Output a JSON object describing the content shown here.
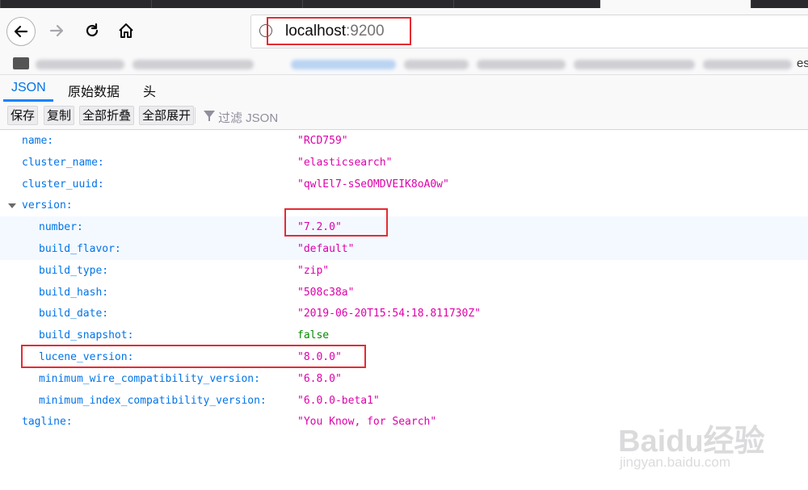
{
  "browser": {
    "url_host": "localhost",
    "url_port": ":9200",
    "bookmark_tail": "es"
  },
  "viewer_tabs": [
    "JSON",
    "原始数据",
    "头"
  ],
  "toolbar": {
    "save": "保存",
    "copy": "复制",
    "collapse_all": "全部折叠",
    "expand_all": "全部展开",
    "filter_placeholder": "过滤 JSON"
  },
  "json": {
    "name": {
      "key": "name:",
      "value": "\"RCD759\""
    },
    "cluster_name": {
      "key": "cluster_name:",
      "value": "\"elasticsearch\""
    },
    "cluster_uuid": {
      "key": "cluster_uuid:",
      "value": "\"qwlEl7-sSeOMDVEIK8oA0w\""
    },
    "version_key": "version:",
    "version": {
      "number": {
        "key": "number:",
        "value": "\"7.2.0\""
      },
      "build_flavor": {
        "key": "build_flavor:",
        "value": "\"default\""
      },
      "build_type": {
        "key": "build_type:",
        "value": "\"zip\""
      },
      "build_hash": {
        "key": "build_hash:",
        "value": "\"508c38a\""
      },
      "build_date": {
        "key": "build_date:",
        "value": "\"2019-06-20T15:54:18.811730Z\""
      },
      "build_snapshot": {
        "key": "build_snapshot:",
        "value": "false"
      },
      "lucene_version": {
        "key": "lucene_version:",
        "value": "\"8.0.0\""
      },
      "minimum_wire_compatibility_version": {
        "key": "minimum_wire_compatibility_version:",
        "value": "\"6.8.0\""
      },
      "minimum_index_compatibility_version": {
        "key": "minimum_index_compatibility_version:",
        "value": "\"6.0.0-beta1\""
      }
    },
    "tagline": {
      "key": "tagline:",
      "value": "\"You Know, for Search\""
    }
  },
  "watermark": {
    "logo": "Baidu经验",
    "site": "jingyan.baidu.com"
  },
  "colors": {
    "key": "#0074e8",
    "string": "#dd00a9",
    "boolean": "#058b00",
    "highlight": "#e52b33"
  }
}
